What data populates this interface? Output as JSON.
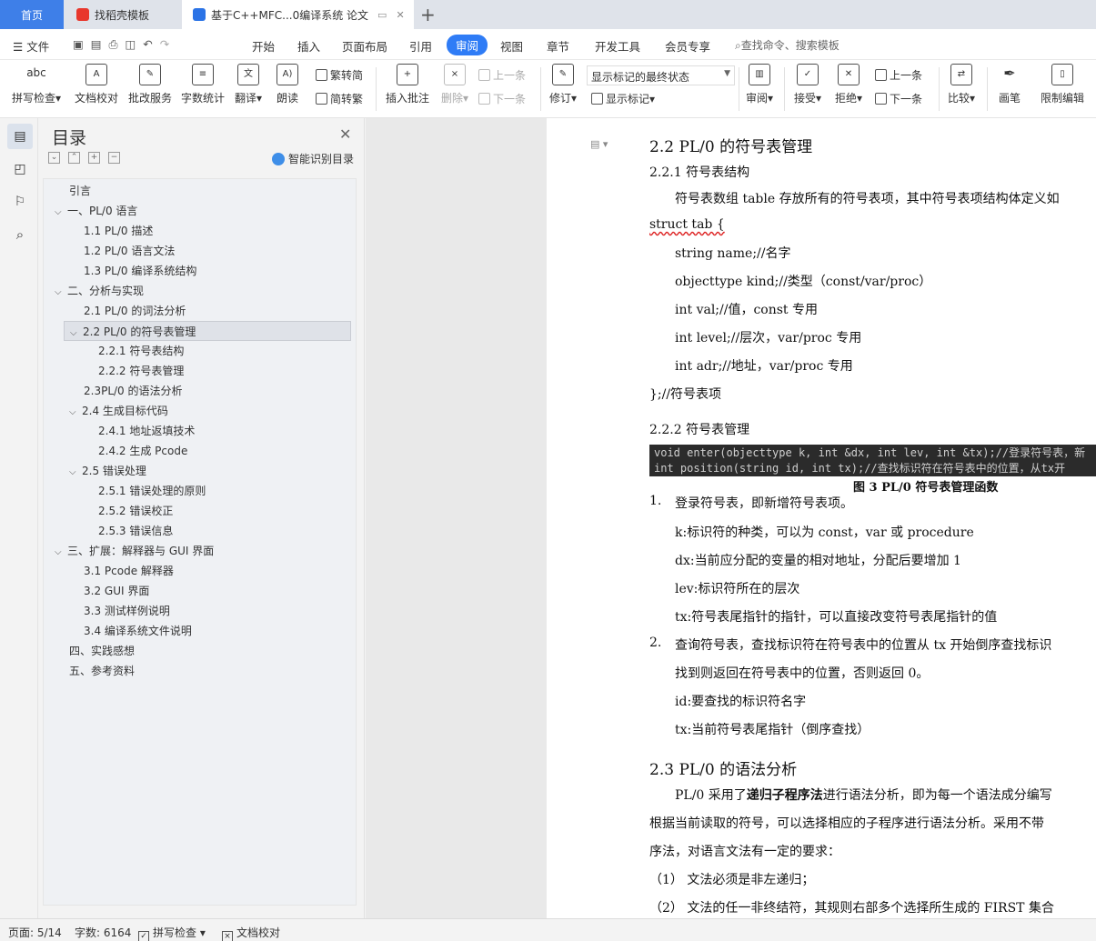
{
  "tabs": {
    "home": "首页",
    "templates": "找稻壳模板",
    "document": "基于C++MFC...0编译系统 论文"
  },
  "menu": {
    "file": "文件",
    "items": [
      "开始",
      "插入",
      "页面布局",
      "引用",
      "审阅",
      "视图",
      "章节",
      "开发工具",
      "会员专享"
    ],
    "active": "审阅",
    "search": "查找命令、搜索模板"
  },
  "ribbon": {
    "spell_check": "拼写检查",
    "doc_check": "文档校对",
    "review_service": "批改服务",
    "word_count": "字数统计",
    "translate": "翻译",
    "read_aloud": "朗读",
    "to_simplified": "繁转简",
    "to_traditional": "简转繁",
    "insert_comment": "插入批注",
    "delete": "删除",
    "prev_item": "上一条",
    "next_item": "下一条",
    "track_changes": "修订",
    "markup_mode": "显示标记的最终状态",
    "show_markup": "显示标记",
    "review_pane": "审阅",
    "accept": "接受",
    "reject": "拒绝",
    "prev_change": "上一条",
    "next_change": "下一条",
    "compare": "比较",
    "pen": "画笔",
    "restrict": "限制编辑"
  },
  "nav": {
    "title": "目录",
    "smart_toc": "智能识别目录",
    "items": [
      {
        "label": "引言"
      },
      {
        "label": "一、PL/0 语言"
      },
      {
        "label": "1.1 PL/0 描述"
      },
      {
        "label": "1.2 PL/0 语言文法"
      },
      {
        "label": "1.3 PL/0 编译系统结构"
      },
      {
        "label": "二、分析与实现"
      },
      {
        "label": "2.1 PL/0 的词法分析"
      },
      {
        "label": "2.2 PL/0 的符号表管理"
      },
      {
        "label": "2.2.1 符号表结构"
      },
      {
        "label": "2.2.2 符号表管理"
      },
      {
        "label": "2.3PL/0 的语法分析"
      },
      {
        "label": "2.4  生成目标代码"
      },
      {
        "label": "2.4.1  地址返填技术"
      },
      {
        "label": "2.4.2 生成 Pcode"
      },
      {
        "label": "2.5 错误处理"
      },
      {
        "label": "2.5.1 错误处理的原则"
      },
      {
        "label": "2.5.2 错误校正"
      },
      {
        "label": "2.5.3 错误信息"
      },
      {
        "label": "三、扩展：解释器与 GUI 界面"
      },
      {
        "label": "3.1 Pcode 解释器"
      },
      {
        "label": "3.2 GUI 界面"
      },
      {
        "label": "3.3  测试样例说明"
      },
      {
        "label": "3.4  编译系统文件说明"
      },
      {
        "label": "四、实践感想"
      },
      {
        "label": "五、参考资料"
      }
    ]
  },
  "doc": {
    "h_2_2": "2.2 PL/0 的符号表管理",
    "h_2_2_1": "2.2.1 符号表结构",
    "para_struct": "符号表数组 table 存放所有的符号表项，其中符号表项结构体定义如",
    "struct_open": "struct tab {",
    "field_name": "string name;//名字",
    "field_kind": "objecttype kind;//类型（const/var/proc）",
    "field_val": "int val;//值，const 专用",
    "field_level": "int level;//层次，var/proc 专用",
    "field_adr": "int adr;//地址，var/proc 专用",
    "struct_close": "};//符号表项",
    "h_2_2_2": "2.2.2 符号表管理",
    "code_line1": "void enter(objecttype k, int &dx, int lev, int &tx);//登录符号表，新",
    "code_line2": "int position(string id, int tx);//查找标识符在符号表中的位置，从tx开",
    "figure_caption": "图 3 PL/0 符号表管理函数",
    "item1_num": "1.",
    "item1": "登录符号表，即新增符号表项。",
    "item1_k": "k:标识符的种类，可以为 const，var 或 procedure",
    "item1_dx": "dx:当前应分配的变量的相对地址，分配后要增加 1",
    "item1_lev": "lev:标识符所在的层次",
    "item1_tx": "tx:符号表尾指针的指针，可以直接改变符号表尾指针的值",
    "item2_num": "2.",
    "item2": "查询符号表，查找标识符在符号表中的位置从 tx 开始倒序查找标识",
    "item2_cont": "找到则返回在符号表中的位置，否则返回 0。",
    "item2_id": "id:要查找的标识符名字",
    "item2_tx": "tx:当前符号表尾指针（倒序查找）",
    "h_2_3": "2.3 PL/0 的语法分析",
    "para_23a_pre": "PL/0 采用了",
    "para_23a_bold": "递归子程序法",
    "para_23a_post": "进行语法分析，即为每一个语法成分编写",
    "para_23b": "根据当前读取的符号，可以选择相应的子程序进行语法分析。采用不带",
    "para_23c": "序法，对语言文法有一定的要求：",
    "cond1": "（1）  文法必须是非左递归；",
    "cond2": "（2）  文法的任一非终结符，其规则右部多个选择所生成的 FIRST 集合"
  },
  "status": {
    "page": "页面: 5/14",
    "words": "字数: 6164",
    "spell": "拼写检查",
    "doc_check": "文档校对"
  },
  "colors": {
    "accent": "#2f7cf6",
    "home_tab": "#3e7fe8",
    "spell_underline": "#dd2222"
  }
}
